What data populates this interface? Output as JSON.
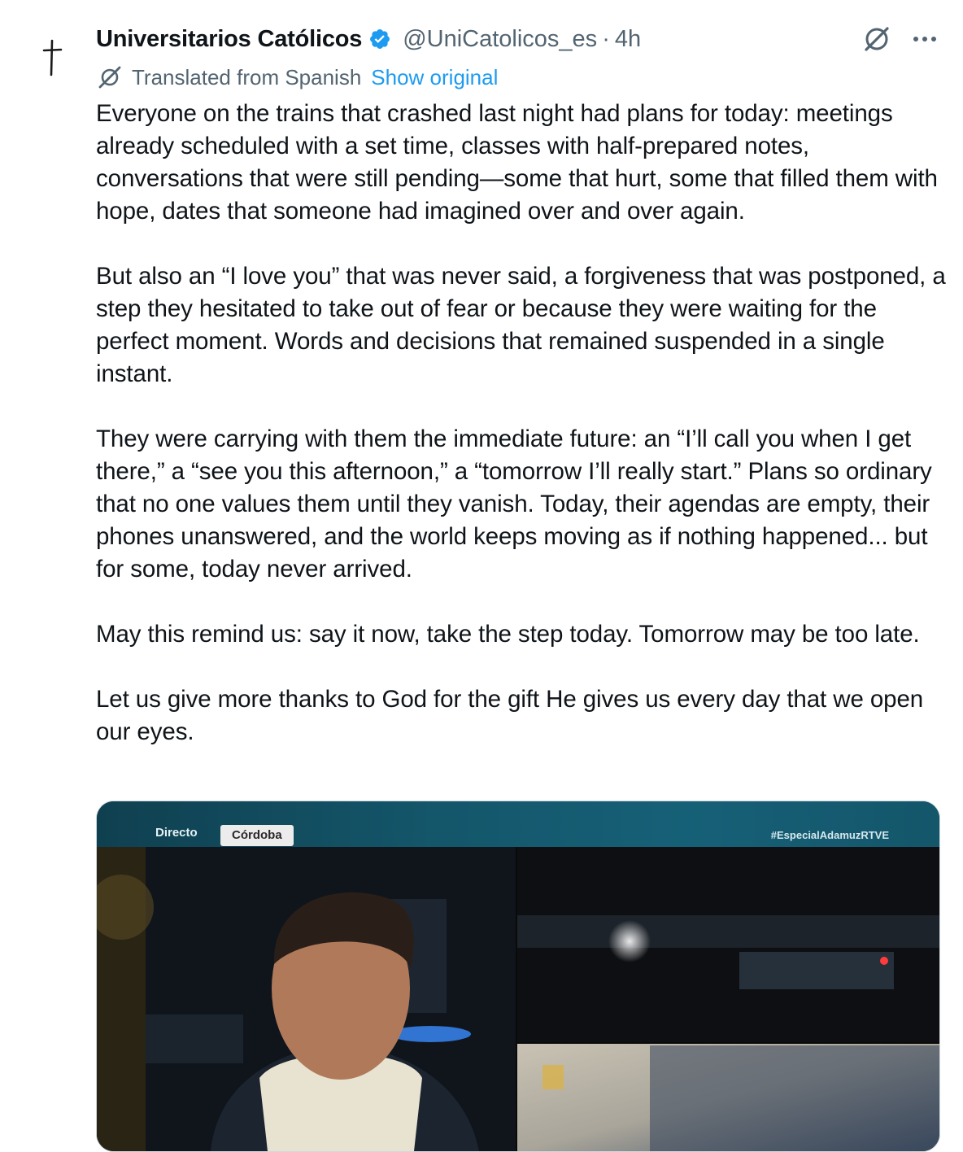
{
  "author": {
    "display_name": "Universitarios Católicos",
    "handle": "@UniCatolicos_es",
    "separator": "·",
    "time": "4h",
    "avatar_icon": "cross-icon",
    "verified_color": "#1d9bf0"
  },
  "translation": {
    "label": "Translated from Spanish",
    "action": "Show original",
    "icon": "translate-icon"
  },
  "tweet": {
    "paragraphs": [
      "Everyone on the trains that crashed last night had plans for today: meetings already scheduled with a set time, classes with half-prepared notes, conversations that were still pending—some that hurt, some that filled them with hope, dates that someone had imagined over and over again.",
      "But also an “I love you” that was never said, a forgiveness that was postponed, a step they hesitated to take out of fear or because they were waiting for the perfect moment. Words and decisions that remained suspended in a single instant.",
      "They were carrying with them the immediate future: an “I’ll call you when I get there,” a “see you this afternoon,” a “tomorrow I’ll really start.” Plans so ordinary that no one values them until they vanish. Today, their agendas are empty, their phones unanswered, and the world keeps moving as if nothing happened... but for some, today never arrived.",
      "May this remind us: say it now, take the step today. Tomorrow may be too late.",
      "Let us give more thanks to God for the gift He gives us every day that we open our eyes."
    ]
  },
  "media": {
    "live_label": "Directo",
    "location_label": "Córdoba",
    "hashtag": "#EspecialAdamuzRTVE"
  },
  "colors": {
    "text": "#0f1419",
    "secondary": "#536471",
    "link": "#1d9bf0",
    "border": "#cfd9de"
  }
}
